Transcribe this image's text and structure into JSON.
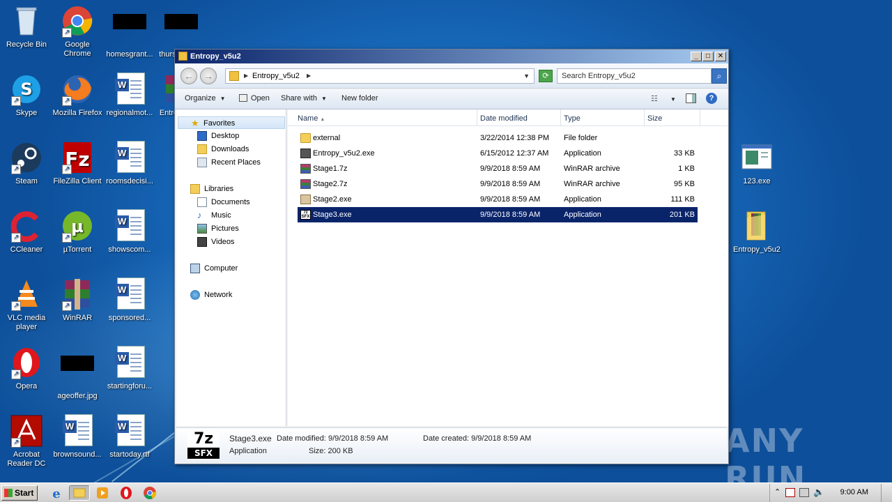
{
  "desktop": {
    "icons": [
      {
        "label": "Recycle Bin"
      },
      {
        "label": "Google Chrome"
      },
      {
        "label": "homesgrant..."
      },
      {
        "label": "thursdayba..."
      },
      {
        "label": "Skype"
      },
      {
        "label": "Mozilla Firefox"
      },
      {
        "label": "regionalmot..."
      },
      {
        "label": "Entre"
      },
      {
        "label": "Steam"
      },
      {
        "label": "FileZilla Client"
      },
      {
        "label": "roomsdecisi..."
      },
      {
        "label": "CCleaner"
      },
      {
        "label": "µTorrent"
      },
      {
        "label": "showscom..."
      },
      {
        "label": "VLC media player"
      },
      {
        "label": "WinRAR"
      },
      {
        "label": "sponsored..."
      },
      {
        "label": "Opera"
      },
      {
        "label": "ageoffer.jpg"
      },
      {
        "label": "startingforu..."
      },
      {
        "label": "Acrobat Reader DC"
      },
      {
        "label": "brownsound..."
      },
      {
        "label": "startoday.rtf"
      },
      {
        "label": "123.exe"
      },
      {
        "label": "Entropy_v5u2"
      }
    ],
    "watermark": "ANY RUN"
  },
  "window": {
    "title": "Entropy_v5u2",
    "controls": {
      "minimize": "_",
      "maximize": "□",
      "close": "✕"
    },
    "address": {
      "path": "Entropy_v5u2",
      "search_placeholder": "Search Entropy_v5u2"
    },
    "toolbar": {
      "organize": "Organize",
      "open": "Open",
      "share_with": "Share with",
      "new_folder": "New folder"
    },
    "nav": {
      "favorites": "Favorites",
      "desktop": "Desktop",
      "downloads": "Downloads",
      "recent_places": "Recent Places",
      "libraries": "Libraries",
      "documents": "Documents",
      "music": "Music",
      "pictures": "Pictures",
      "videos": "Videos",
      "computer": "Computer",
      "network": "Network"
    },
    "columns": {
      "name": "Name",
      "date_modified": "Date modified",
      "type": "Type",
      "size": "Size"
    },
    "files": [
      {
        "name": "external",
        "date": "3/22/2014 12:38 PM",
        "type": "File folder",
        "size": ""
      },
      {
        "name": "Entropy_v5u2.exe",
        "date": "6/15/2012 12:37 AM",
        "type": "Application",
        "size": "33 KB"
      },
      {
        "name": "Stage1.7z",
        "date": "9/9/2018 8:59 AM",
        "type": "WinRAR archive",
        "size": "1 KB"
      },
      {
        "name": "Stage2.7z",
        "date": "9/9/2018 8:59 AM",
        "type": "WinRAR archive",
        "size": "95 KB"
      },
      {
        "name": "Stage2.exe",
        "date": "9/9/2018 8:59 AM",
        "type": "Application",
        "size": "111 KB"
      },
      {
        "name": "Stage3.exe",
        "date": "9/9/2018 8:59 AM",
        "type": "Application",
        "size": "201 KB"
      }
    ],
    "details": {
      "icon_top": "7z",
      "icon_bottom": "SFX",
      "filename": "Stage3.exe",
      "date_modified": "Date modified: 9/9/2018 8:59 AM",
      "date_created": "Date created: 9/9/2018 8:59 AM",
      "type": "Application",
      "size": "Size: 200 KB"
    }
  },
  "taskbar": {
    "start": "Start",
    "clock": "9:00 AM"
  }
}
